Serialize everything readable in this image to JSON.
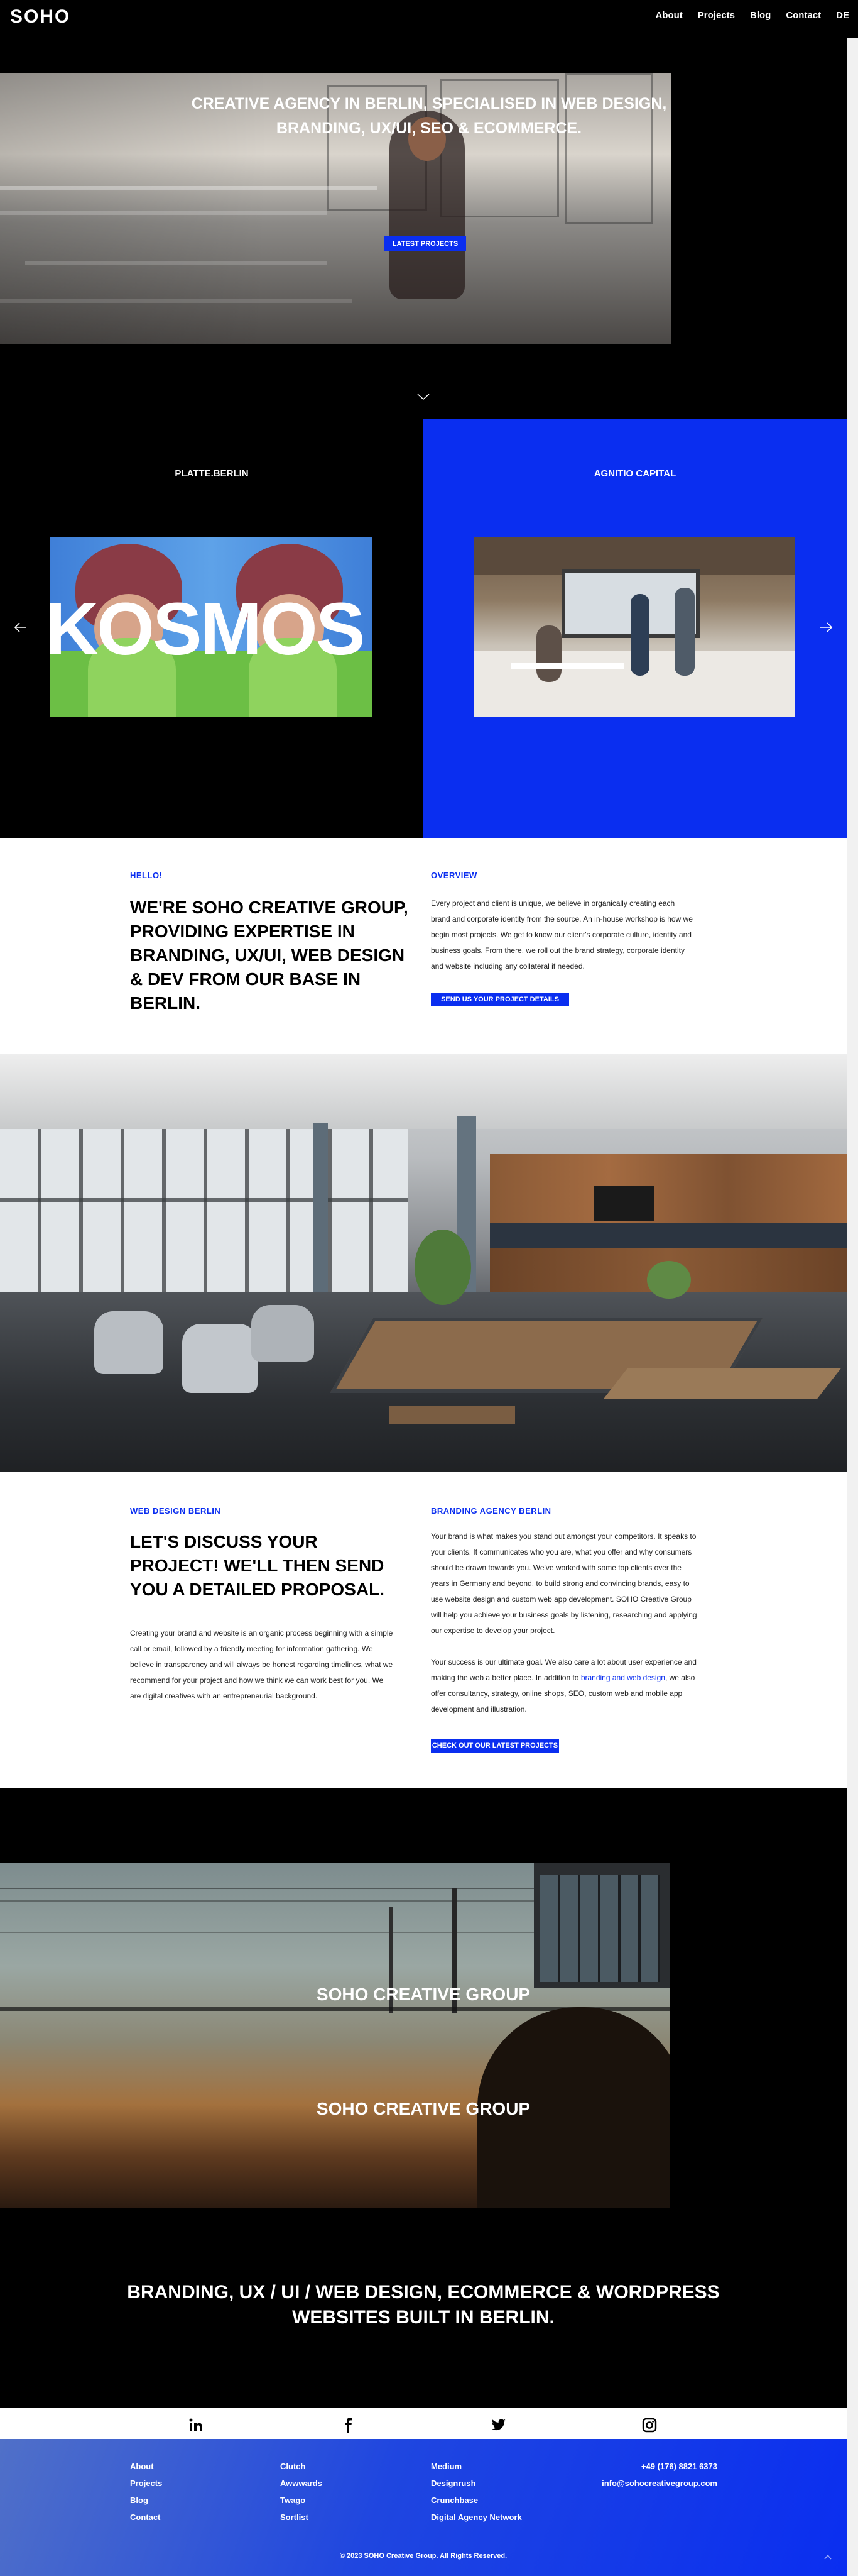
{
  "header": {
    "logo": "SOHO",
    "nav": [
      "About",
      "Projects",
      "Blog",
      "Contact",
      "DE"
    ]
  },
  "hero": {
    "title_line1": "CREATIVE AGENCY IN BERLIN, SPECIALISED IN WEB DESIGN,",
    "title_line2": "BRANDING, UX/UI, SEO & ECOMMERCE.",
    "button": "LATEST PROJECTS"
  },
  "projects": {
    "left_name": "PLATTE.BERLIN",
    "left_image_text": "KOSMOS",
    "right_name": "AGNITIO CAPITAL"
  },
  "intro": {
    "eyebrow_left": "HELLO!",
    "title_lines": [
      "WE'RE SOHO CREATIVE GROUP,",
      "PROVIDING EXPERTISE IN",
      "BRANDING, UX/UI, WEB DESIGN",
      "& DEV FROM OUR BASE IN",
      "BERLIN."
    ],
    "eyebrow_right": "OVERVIEW",
    "overview_lines": [
      "Every project and client is unique, we believe in organically creating each",
      "brand and corporate identity from the source. An in-house workshop is how we",
      "begin most projects. We get to know our client's corporate culture, identity and",
      "business goals. From there, we roll out the brand strategy, corporate identity",
      "and website including any collateral if needed."
    ],
    "button": "SEND US YOUR PROJECT DETAILS"
  },
  "discuss": {
    "eyebrow_left": "WEB DESIGN BERLIN",
    "title_lines": [
      "LET'S DISCUSS YOUR",
      "PROJECT! WE'LL THEN SEND",
      "YOU A DETAILED PROPOSAL."
    ],
    "left_lines": [
      "Creating your brand and website is an organic process beginning with a simple",
      "call or email, followed by a friendly meeting for information gathering. We",
      "believe in transparency and will always be honest regarding timelines, what we",
      "recommend for your project and how we think we can work best for you. We",
      "are digital creatives with an entrepreneurial background."
    ],
    "eyebrow_right": "BRANDING AGENCY BERLIN",
    "right_lines": [
      "Your brand is what makes you stand out amongst your competitors. It speaks to",
      "your clients. It communicates who you are, what you offer and why consumers",
      "should be drawn towards you. We've worked with some top clients over the",
      "years in Germany and beyond, to build strong and convincing brands, easy to",
      "use website design and custom web app development. SOHO Creative Group",
      "will help you achieve your business goals by listening, researching and applying",
      "our expertise to develop your project."
    ],
    "right2_line1_a": "Your success is our ultimate goal. We also care a lot about user experience and",
    "right2_line2_a": "making the web a better place. In addition to ",
    "right2_link": "branding and web design",
    "right2_line2_b": ", we also",
    "right2_line3": "offer consultancy, strategy, online shops, SEO, custom web and mobile app",
    "right2_line4": "development and illustration.",
    "button": "CHECK OUT OUR LATEST PROJECTS"
  },
  "brand_section": {
    "soho_1": "SOHO CREATIVE GROUP",
    "soho_2": "SOHO CREATIVE GROUP",
    "tagline_line1": "BRANDING, UX / UI / WEB DESIGN, ECOMMERCE & WORDPRESS",
    "tagline_line2": "WEBSITES BUILT IN BERLIN."
  },
  "social": {
    "icons": [
      "linkedin-icon",
      "facebook-icon",
      "twitter-icon",
      "instagram-icon"
    ]
  },
  "footer": {
    "col1": [
      "About",
      "Projects",
      "Blog",
      "Contact"
    ],
    "col2": [
      "Clutch",
      "Awwwards",
      "Twago",
      "Sortlist"
    ],
    "col3": [
      "Medium",
      "Designrush",
      "Crunchbase",
      "Digital Agency Network"
    ],
    "phone": "+49 (176) 8821 6373",
    "email": "info@sohocreativegroup.com",
    "copyright": "© 2023 SOHO Creative Group. All Rights Reserved."
  },
  "colors": {
    "accent": "#0a2ef0",
    "dark": "#000000",
    "light": "#ffffff"
  }
}
